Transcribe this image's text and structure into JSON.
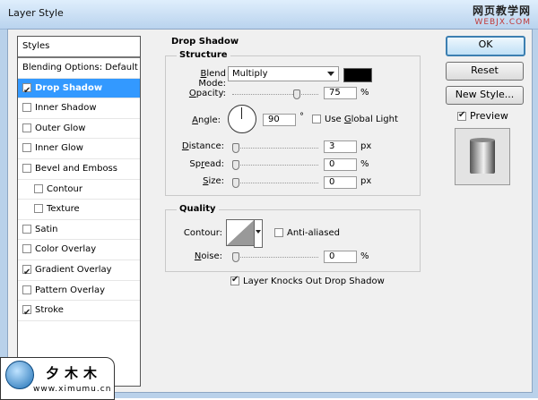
{
  "window": {
    "title": "Layer Style"
  },
  "watermark": {
    "site_cn": "网页教学网",
    "site_url": "WEBJX.COM"
  },
  "sidebar": {
    "header": "Styles",
    "items": [
      {
        "label": "Blending Options: Default",
        "checkbox": false,
        "checked": false,
        "selected": false,
        "indent": false
      },
      {
        "label": "Drop Shadow",
        "checkbox": true,
        "checked": true,
        "selected": true,
        "indent": false
      },
      {
        "label": "Inner Shadow",
        "checkbox": true,
        "checked": false,
        "selected": false,
        "indent": false
      },
      {
        "label": "Outer Glow",
        "checkbox": true,
        "checked": false,
        "selected": false,
        "indent": false
      },
      {
        "label": "Inner Glow",
        "checkbox": true,
        "checked": false,
        "selected": false,
        "indent": false
      },
      {
        "label": "Bevel and Emboss",
        "checkbox": true,
        "checked": false,
        "selected": false,
        "indent": false
      },
      {
        "label": "Contour",
        "checkbox": true,
        "checked": false,
        "selected": false,
        "indent": true
      },
      {
        "label": "Texture",
        "checkbox": true,
        "checked": false,
        "selected": false,
        "indent": true
      },
      {
        "label": "Satin",
        "checkbox": true,
        "checked": false,
        "selected": false,
        "indent": false
      },
      {
        "label": "Color Overlay",
        "checkbox": true,
        "checked": false,
        "selected": false,
        "indent": false
      },
      {
        "label": "Gradient Overlay",
        "checkbox": true,
        "checked": true,
        "selected": false,
        "indent": false
      },
      {
        "label": "Pattern Overlay",
        "checkbox": true,
        "checked": false,
        "selected": false,
        "indent": false
      },
      {
        "label": "Stroke",
        "checkbox": true,
        "checked": true,
        "selected": false,
        "indent": false
      }
    ]
  },
  "drop_shadow": {
    "title": "Drop Shadow",
    "structure": {
      "title": "Structure",
      "blend_mode_label": "Blend Mode:",
      "blend_mode_value": "Multiply",
      "shadow_color": "#000000",
      "opacity_label": "Opacity:",
      "opacity_value": "75",
      "opacity_unit": "%",
      "opacity_level": 0.75,
      "angle_label": "Angle:",
      "angle_value": "90",
      "angle_unit": "°",
      "use_global_light_label": "Use Global Light",
      "use_global_light_checked": false,
      "distance_label": "Distance:",
      "distance_value": "3",
      "distance_unit": "px",
      "spread_label": "Spread:",
      "spread_value": "0",
      "spread_unit": "%",
      "size_label": "Size:",
      "size_value": "0",
      "size_unit": "px"
    },
    "quality": {
      "title": "Quality",
      "contour_label": "Contour:",
      "anti_aliased_label": "Anti-aliased",
      "anti_aliased_checked": false,
      "noise_label": "Noise:",
      "noise_value": "0",
      "noise_unit": "%"
    },
    "knockout_label": "Layer Knocks Out Drop Shadow",
    "knockout_checked": true
  },
  "buttons": {
    "ok": "OK",
    "reset": "Reset",
    "new_style": "New Style..."
  },
  "preview": {
    "label": "Preview",
    "checked": true
  },
  "logo": {
    "name_cn": "夕木木",
    "url": "www.ximumu.cn"
  },
  "colors": {
    "selection": "#3399ff",
    "window_frame": "#b9d1ea",
    "dialog_bg": "#f0f0f0"
  }
}
